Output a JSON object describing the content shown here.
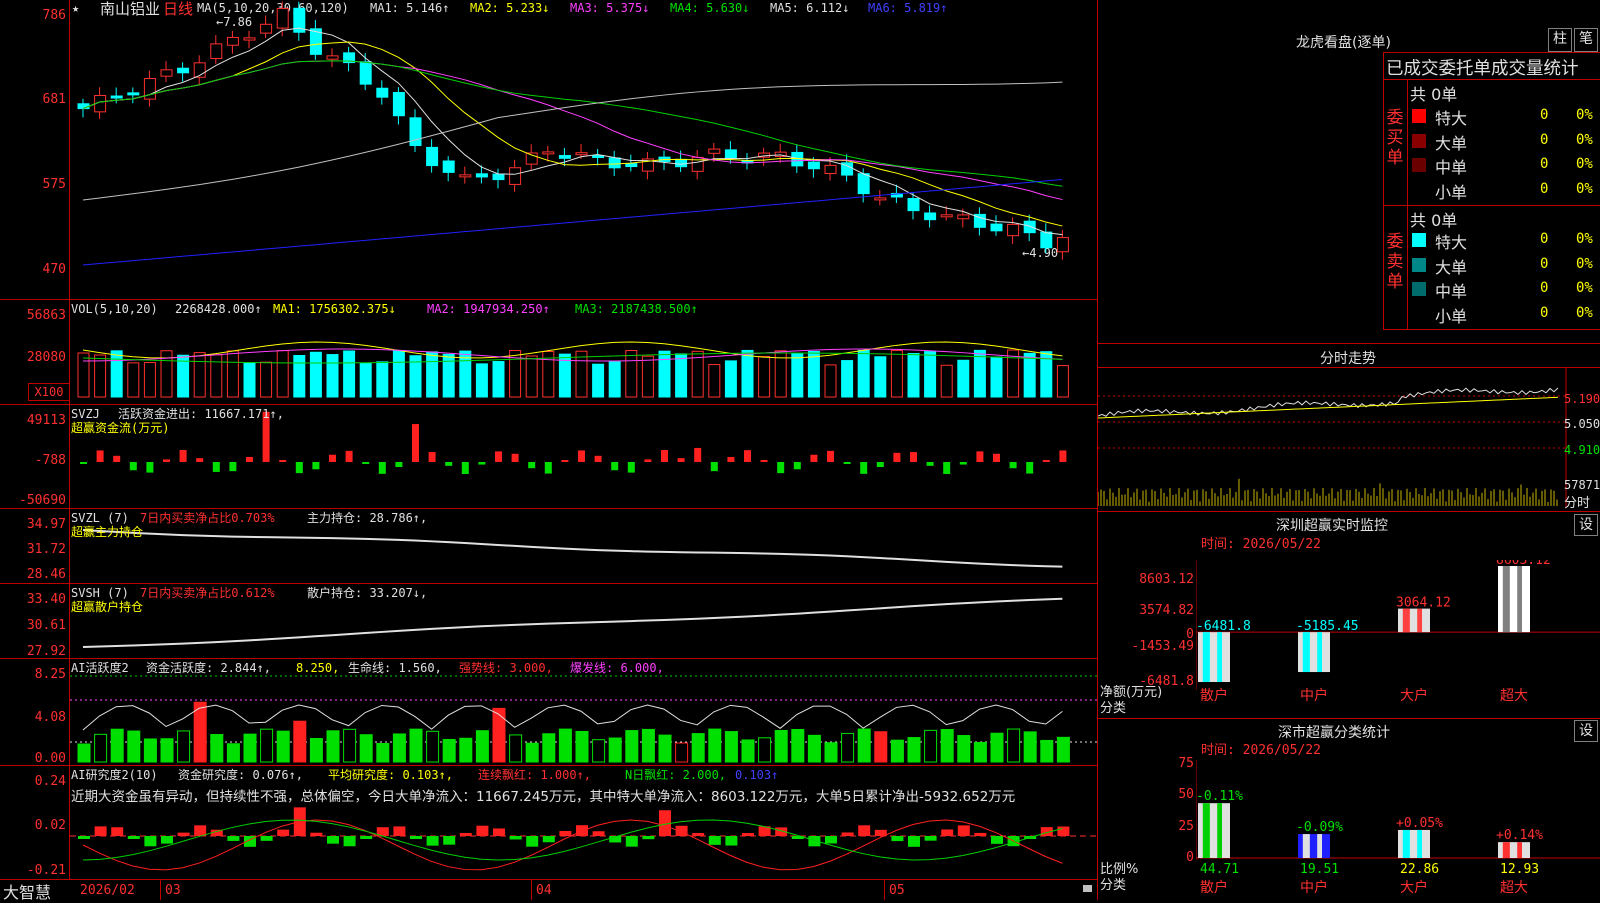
{
  "header": {
    "star": "★",
    "stock_name": "南山铝业",
    "period": "日线",
    "ma_label": "MA(5,10,20,30,60,120)",
    "ma1": "MA1: 5.146↑",
    "ma2": "MA2: 5.233↓",
    "ma3": "MA3: 5.375↓",
    "ma4": "MA4: 5.630↓",
    "ma5": "MA5: 6.112↓",
    "ma6": "MA6: 5.819↑"
  },
  "price_axis": [
    "786",
    "681",
    "575",
    "470"
  ],
  "price_marks": {
    "high": "←7.86",
    "low": "←4.90"
  },
  "vol": {
    "label": "VOL(5,10,20)",
    "value": "2268428.000↑",
    "ma1": "MA1: 1756302.375↓",
    "ma2": "MA2: 1947934.250↑",
    "ma3": "MA3: 2187438.500↑",
    "axis": [
      "56863",
      "28080"
    ],
    "unit": "X100"
  },
  "svzj": {
    "label": "SVZJ",
    "desc": "活跃资金进出: 11667.171↑,",
    "sub": "超赢资金流(万元)",
    "axis": [
      "49113",
      "-788",
      "-50690"
    ]
  },
  "svzl": {
    "label": "SVZL (7)",
    "desc": "7日内买卖净占比0.703%",
    "value": "主力持仓: 28.786↑,",
    "sub": "超赢主力持仓",
    "axis": [
      "34.97",
      "31.72",
      "28.46"
    ]
  },
  "svsh": {
    "label": "SVSH (7)",
    "desc": "7日内买卖净占比0.612%",
    "value": "散户持仓: 33.207↓,",
    "sub": "超赢散户持仓",
    "axis": [
      "33.40",
      "30.61",
      "27.92"
    ]
  },
  "ai1": {
    "label": "AI活跃度2",
    "v1": "资金活跃度: 2.844↑,",
    "v2": "8.250,",
    "v3": "生命线: 1.560,",
    "v4": "强势线: 3.000,",
    "v5": "爆发线: 6.000,",
    "axis": [
      "8.25",
      "4.08",
      "0.00"
    ]
  },
  "ai2": {
    "label": "AI研究度2(10)",
    "v1": "资金研究度: 0.076↑,",
    "v2": "平均研究度: 0.103↑,",
    "v3": "连续飘红: 1.000↑,",
    "v4": "N日飘红: 2.000,",
    "v5": "0.103↑",
    "comment": "近期大资金虽有异动，但持续性不强，总体偏空，今日大单净流入：11667.245万元，其中特大单净流入：8603.122万元，大单5日累计净出-5932.652万元",
    "axis": [
      "0.24",
      "0.02",
      "-0.21"
    ]
  },
  "dates": {
    "corner": "大智慧",
    "d1": "2026/02",
    "d2": "03",
    "d3": "04",
    "d4": "05"
  },
  "right": {
    "title": "龙虎看盘(逐单)",
    "btn1": "柱",
    "btn2": "笔",
    "stats_title": "已成交委托单成交量统计",
    "buy_label": "委买单",
    "sell_label": "委卖单",
    "buy_total": "共 0单",
    "sell_total": "共 0单",
    "buy_rows": [
      {
        "name": "特大",
        "count": "0",
        "pct": "0%",
        "color": "#ff0000"
      },
      {
        "name": "大单",
        "count": "0",
        "pct": "0%",
        "color": "#8a0000"
      },
      {
        "name": "中单",
        "count": "0",
        "pct": "0%",
        "color": "#6a0000"
      },
      {
        "name": "小单",
        "count": "0",
        "pct": "0%",
        "color": "#000000"
      }
    ],
    "sell_rows": [
      {
        "name": "特大",
        "count": "0",
        "pct": "0%",
        "color": "#00ffff"
      },
      {
        "name": "大单",
        "count": "0",
        "pct": "0%",
        "color": "#008888"
      },
      {
        "name": "中单",
        "count": "0",
        "pct": "0%",
        "color": "#006c6c"
      },
      {
        "name": "小单",
        "count": "0",
        "pct": "0%",
        "color": "#000000"
      }
    ],
    "intraday_title": "分时走势",
    "intraday_axis": [
      "5.190",
      "5.050",
      "4.910",
      "57871"
    ],
    "intraday_unit": "分时"
  },
  "monitor": {
    "title": "深圳超赢实时监控",
    "btn": "设",
    "time": "时间: 2026/05/22",
    "axis": [
      "8603.12",
      "3574.82",
      "0",
      "-1453.49",
      "-6481.8"
    ],
    "y_label": "净额(万元)",
    "x_label": "分类",
    "categories": [
      "散户",
      "中户",
      "大户",
      "超大"
    ],
    "values": [
      -6481.8,
      -5185.45,
      3064.12,
      8603.12
    ],
    "labels": [
      "-6481.8",
      "-5185.45",
      "3064.12",
      "8603.12"
    ]
  },
  "classify": {
    "title": "深市超赢分类统计",
    "btn": "设",
    "time": "时间: 2026/05/22",
    "axis": [
      "75",
      "50",
      "25",
      "0"
    ],
    "y_label": "比例%",
    "x_label": "分类",
    "categories": [
      "散户",
      "中户",
      "大户",
      "超大"
    ],
    "values": [
      44.71,
      19.51,
      22.86,
      12.93
    ],
    "changes": [
      "-0.11%",
      "-0.09%",
      "+0.05%",
      "+0.14%"
    ],
    "bottom": [
      "44.71",
      "19.51",
      "22.86",
      "12.93"
    ]
  },
  "colors": {
    "up": "#ff3030",
    "down": "#00ffff",
    "grid": "#c00000"
  }
}
